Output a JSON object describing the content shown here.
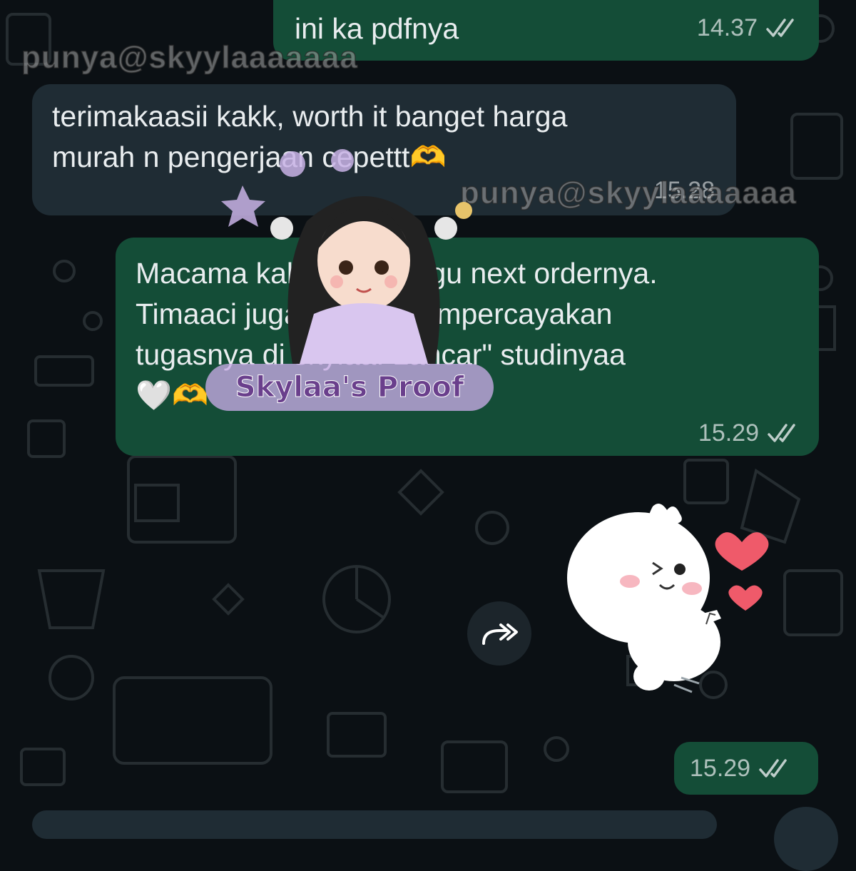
{
  "colors": {
    "chat_bg": "#0b1014",
    "outgoing_bubble": "#144d37",
    "incoming_bubble": "#1f2c34",
    "text": "#e9edef",
    "heart_red": "#ef5a6a"
  },
  "messages": [
    {
      "direction": "outgoing",
      "text": "ini ka pdfnya",
      "time": "14.37",
      "status": "read-double-check-icon"
    },
    {
      "direction": "incoming",
      "text": "terimakaasii kakk, worth it banget harga\nmurah n pengerjaan cepettt🫶",
      "time": "15.28"
    },
    {
      "direction": "outgoing",
      "text": "Macama kakaa di tunggu next ordernya.\nTimaaci juga sudah mempercayakan\ntugasnya di skylaa. Lancar\" studinyaa\n🤍🫶",
      "time": "15.29",
      "status": "read-double-check-icon"
    },
    {
      "direction": "outgoing",
      "type": "sticker",
      "sticker": "cute-white-character-hearts-sticker",
      "time": "15.29",
      "status": "read-double-check-icon"
    }
  ],
  "watermarks": {
    "top_left": "punya@skyylaaaaaaa",
    "middle_right": "punya@skyylaaaaaaa",
    "proof_label": "Skylaa's Proof"
  },
  "icons": {
    "forward": "forward-arrow-icon",
    "chat_pattern": "whatsapp-doodle-background"
  }
}
